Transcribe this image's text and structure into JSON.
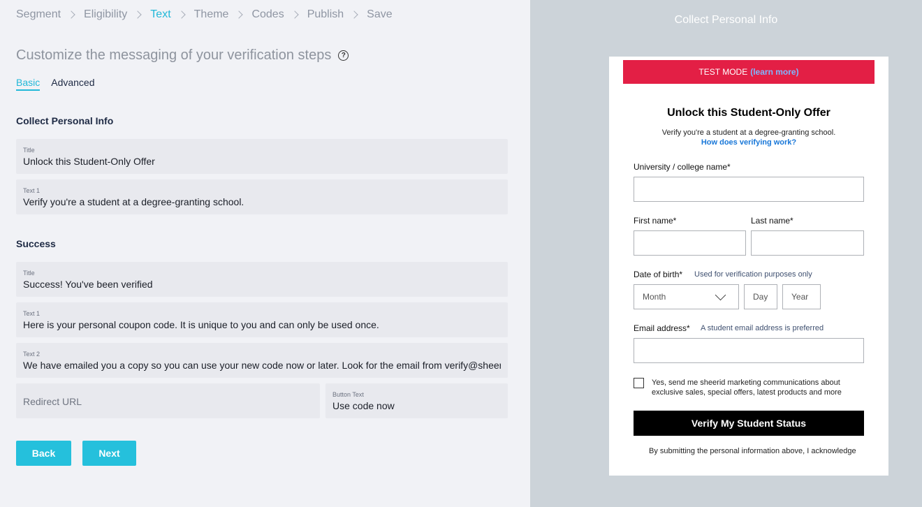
{
  "breadcrumb": {
    "steps": [
      "Segment",
      "Eligibility",
      "Text",
      "Theme",
      "Codes",
      "Publish",
      "Save"
    ],
    "active": "Text"
  },
  "editor": {
    "heading": "Customize the messaging of your verification steps",
    "help_icon": "?",
    "tabs": [
      "Basic",
      "Advanced"
    ],
    "active_tab": "Basic",
    "collect": {
      "section_title": "Collect Personal Info",
      "title_label": "Title",
      "title_value": "Unlock this Student-Only Offer",
      "text1_label": "Text 1",
      "text1_value": "Verify you're a student at a degree-granting school."
    },
    "success": {
      "section_title": "Success",
      "title_label": "Title",
      "title_value": "Success! You've been verified",
      "text1_label": "Text 1",
      "text1_value": "Here is your personal coupon code. It is unique to you and can only be used once.",
      "text2_label": "Text 2",
      "text2_value": "We have emailed you a copy so you can use your new code now or later. Look for the email from verify@sheerid.com.",
      "redirect_placeholder": "Redirect URL",
      "button_text_label": "Button Text",
      "button_text_value": "Use code now"
    },
    "back_label": "Back",
    "next_label": "Next"
  },
  "preview": {
    "panel_title": "Collect Personal Info",
    "test_mode": "TEST MODE",
    "learn_more": "(learn more)",
    "title": "Unlock this Student-Only Offer",
    "subtitle": "Verify you're a student at a degree-granting school.",
    "how_link": "How does verifying work?",
    "university_label": "University / college name*",
    "first_name_label": "First name*",
    "last_name_label": "Last name*",
    "dob_label": "Date of birth*",
    "dob_hint": "Used for verification purposes only",
    "month_placeholder": "Month",
    "day_placeholder": "Day",
    "year_placeholder": "Year",
    "email_label": "Email address*",
    "email_hint": "A student email address is preferred",
    "optin_text": "Yes, send me sheerid marketing communications about exclusive sales, special offers, latest products and more",
    "submit_label": "Verify My Student Status",
    "legal_text": "By submitting the personal information above, I acknowledge"
  },
  "colors": {
    "accent": "#22b8d8",
    "button": "#25c0dc",
    "test_mode_bg": "#e31f45",
    "preview_bg": "#ccd3d9"
  }
}
